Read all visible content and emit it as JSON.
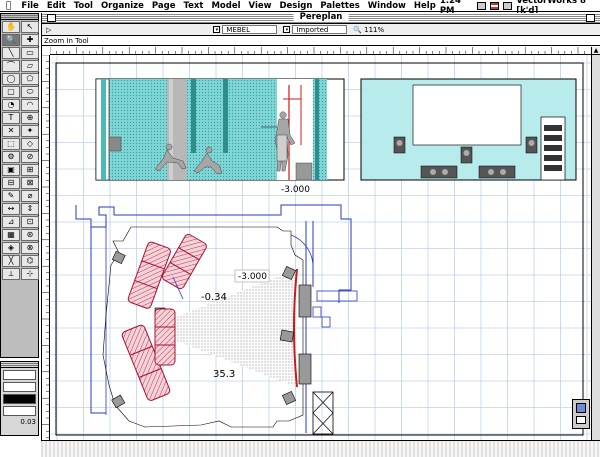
{
  "menubar": {
    "apple": "",
    "items": [
      "File",
      "Edit",
      "Tool",
      "Organize",
      "Page",
      "Text",
      "Model",
      "View",
      "Design",
      "Palettes",
      "Window",
      "Help"
    ],
    "clock": "1:24 PM",
    "app_name": "VectorWorks 8 [k'd]"
  },
  "window": {
    "title": "Pereplan"
  },
  "databar": {
    "class_value": "MEBEL",
    "layer_value": "Imported",
    "zoom_value": "111%"
  },
  "modebar": {
    "mode_text": "Zoom In Tool"
  },
  "palette": {
    "tools": [
      "✋",
      "↖",
      "🔍",
      "✚",
      "╲",
      "▭",
      "⌒",
      "▱",
      "◯",
      "⬠",
      "▢",
      "⬭",
      "◔",
      "◠",
      "T",
      "⊕",
      "✕",
      "✦",
      "⬚",
      "◇",
      "⚙",
      "⊘",
      "▣",
      "⊞",
      "⊟",
      "⊠",
      "✎",
      "⌀",
      "↔",
      "⇕",
      "⊿",
      "⊡",
      "▦",
      "⊛",
      "◈",
      "⊗",
      "╳",
      "⌬",
      "⟂",
      "⊹"
    ]
  },
  "attributes": {
    "line_weight": "0.03"
  },
  "drawing": {
    "elevation_label": "-3.000",
    "plan_label_top": "-3.000",
    "plan_label_angle": "-0.34",
    "plan_label_distance": "35.3"
  },
  "colors": {
    "grid": "#bcd2ee",
    "cyan_fill": "#7fd6d6",
    "cyan_light": "#b8ecec",
    "screen_cone": "#bdbdbd",
    "sofa": "#e8a8b4",
    "sofa_stroke": "#a81030",
    "wall_blue": "#2a3ac0",
    "red_line": "#d01818"
  }
}
